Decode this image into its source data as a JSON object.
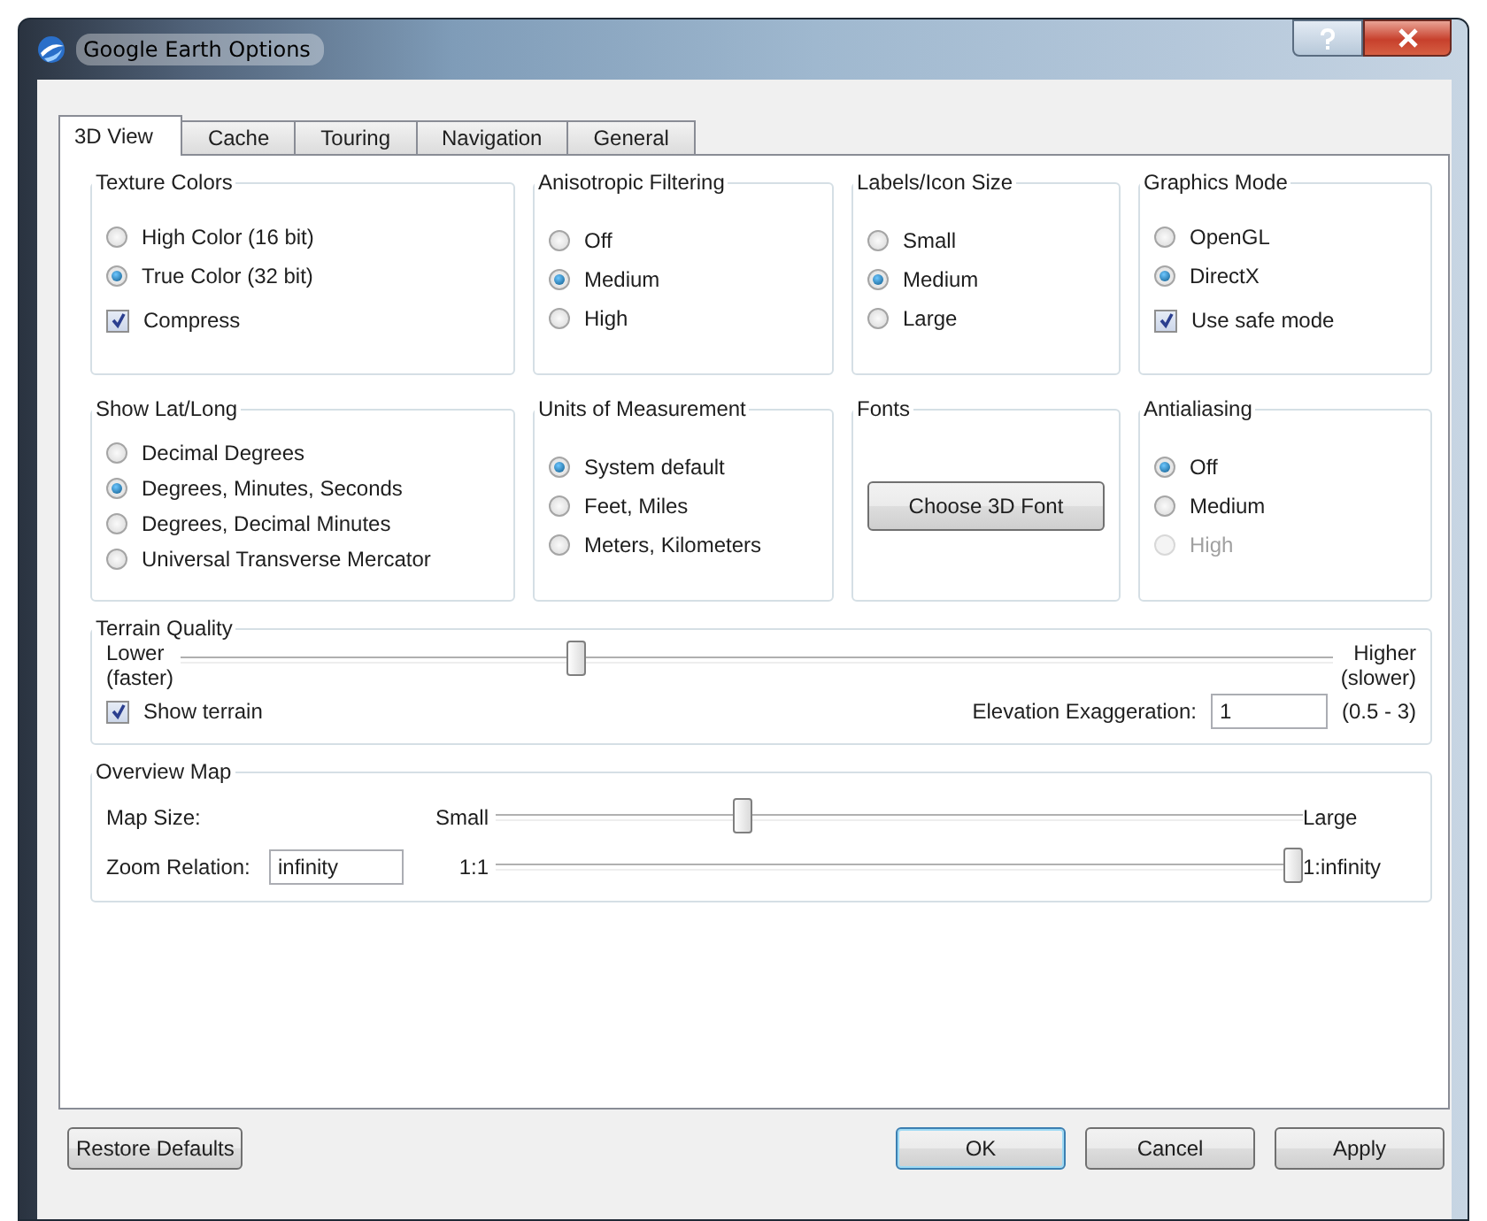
{
  "window": {
    "title": "Google Earth Options"
  },
  "tabs": [
    {
      "label": "3D View",
      "selected": true
    },
    {
      "label": "Cache",
      "selected": false
    },
    {
      "label": "Touring",
      "selected": false
    },
    {
      "label": "Navigation",
      "selected": false
    },
    {
      "label": "General",
      "selected": false
    }
  ],
  "option_groups": [
    {
      "title": "Texture Colors",
      "items": [
        {
          "kind": "radio",
          "label": "High Color (16 bit)",
          "selected": false
        },
        {
          "kind": "radio",
          "label": "True Color (32 bit)",
          "selected": true
        },
        {
          "kind": "checkbox",
          "label": "Compress",
          "checked": true
        }
      ]
    },
    {
      "title": "Anisotropic Filtering",
      "items": [
        {
          "kind": "radio",
          "label": "Off",
          "selected": false
        },
        {
          "kind": "radio",
          "label": "Medium",
          "selected": true
        },
        {
          "kind": "radio",
          "label": "High",
          "selected": false
        }
      ]
    },
    {
      "title": "Labels/Icon Size",
      "items": [
        {
          "kind": "radio",
          "label": "Small",
          "selected": false
        },
        {
          "kind": "radio",
          "label": "Medium",
          "selected": true
        },
        {
          "kind": "radio",
          "label": "Large",
          "selected": false
        }
      ]
    },
    {
      "title": "Graphics Mode",
      "items": [
        {
          "kind": "radio",
          "label": "OpenGL",
          "selected": false
        },
        {
          "kind": "radio",
          "label": "DirectX",
          "selected": true
        },
        {
          "kind": "checkbox",
          "label": "Use safe mode",
          "checked": true
        }
      ]
    },
    {
      "title": "Show Lat/Long",
      "items": [
        {
          "kind": "radio",
          "label": "Decimal Degrees",
          "selected": false
        },
        {
          "kind": "radio",
          "label": "Degrees, Minutes, Seconds",
          "selected": true
        },
        {
          "kind": "radio",
          "label": "Degrees, Decimal Minutes",
          "selected": false
        },
        {
          "kind": "radio",
          "label": "Universal Transverse Mercator",
          "selected": false
        }
      ]
    },
    {
      "title": "Units of Measurement",
      "items": [
        {
          "kind": "radio",
          "label": "System default",
          "selected": true
        },
        {
          "kind": "radio",
          "label": "Feet, Miles",
          "selected": false
        },
        {
          "kind": "radio",
          "label": "Meters, Kilometers",
          "selected": false
        }
      ]
    },
    {
      "title": "Fonts",
      "items": [
        {
          "kind": "button",
          "label": "Choose 3D Font"
        }
      ]
    },
    {
      "title": "Antialiasing",
      "items": [
        {
          "kind": "radio",
          "label": "Off",
          "selected": true,
          "disabled": false
        },
        {
          "kind": "radio",
          "label": "Medium",
          "selected": false,
          "disabled": false
        },
        {
          "kind": "radio",
          "label": "High",
          "selected": false,
          "disabled": true
        }
      ]
    }
  ],
  "terrain_quality": {
    "title": "Terrain Quality",
    "min_label": "Lower (faster)",
    "max_label": "Higher (slower)",
    "level": 0.34,
    "show_terrain": {
      "label": "Show terrain",
      "checked": true
    },
    "elevation": {
      "label": "Elevation Exaggeration:",
      "value": "1",
      "range": "(0.5 - 3)"
    }
  },
  "overview_map": {
    "title": "Overview Map",
    "map_size": {
      "label": "Map Size:",
      "min_label": "Small",
      "max_label": "Large",
      "level": 0.3
    },
    "zoom_relation": {
      "label": "Zoom Relation:",
      "value": "infinity",
      "min_label": "1:1",
      "max_label": "1:infinity",
      "level": 1
    }
  },
  "buttons": [
    {
      "label": "Restore Defaults",
      "default": false
    },
    {
      "label": "OK",
      "default": true
    },
    {
      "label": "Cancel",
      "default": false
    },
    {
      "label": "Apply",
      "default": false
    }
  ]
}
